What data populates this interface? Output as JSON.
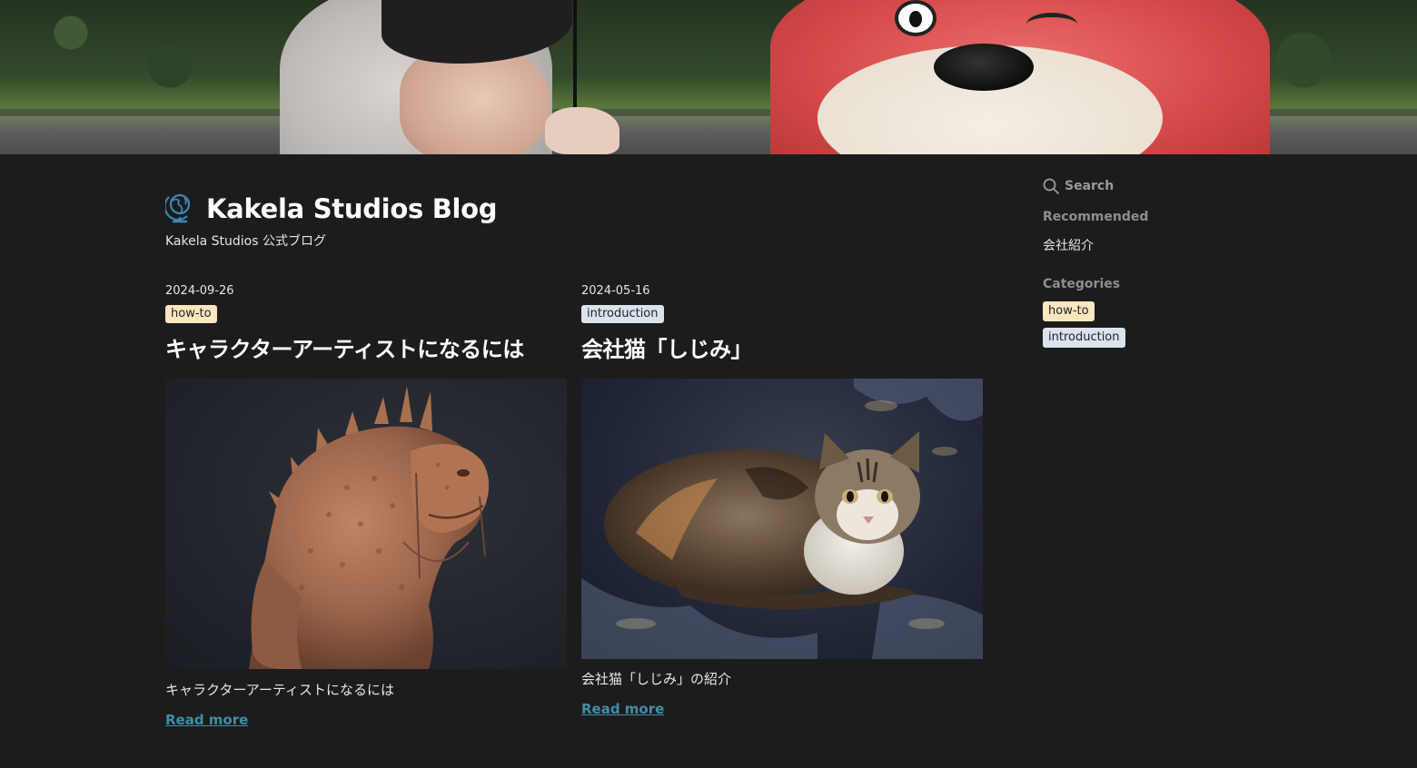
{
  "header": {
    "title": "Kakela Studios Blog",
    "tagline": "Kakela Studios 公式ブログ",
    "logo_icon": "globe-icon"
  },
  "posts": [
    {
      "date": "2024-09-26",
      "tag": "how-to",
      "title": "キャラクターアーティストになるには",
      "excerpt": "キャラクターアーティストになるには",
      "read_more": "Read more"
    },
    {
      "date": "2024-05-16",
      "tag": "introduction",
      "title": "会社猫「しじみ」",
      "excerpt": "会社猫「しじみ」の紹介",
      "read_more": "Read more"
    }
  ],
  "sidebar": {
    "search_label": "Search",
    "recommended_heading": "Recommended",
    "recommended_items": [
      "会社紹介"
    ],
    "categories_heading": "Categories",
    "categories": [
      "how-to",
      "introduction"
    ]
  },
  "colors": {
    "background": "#1c1c1c",
    "link": "#3f8fa8",
    "tag_howto": "#fae6bf",
    "tag_introduction": "#d9e4ef",
    "logo": "#3d86b8"
  }
}
